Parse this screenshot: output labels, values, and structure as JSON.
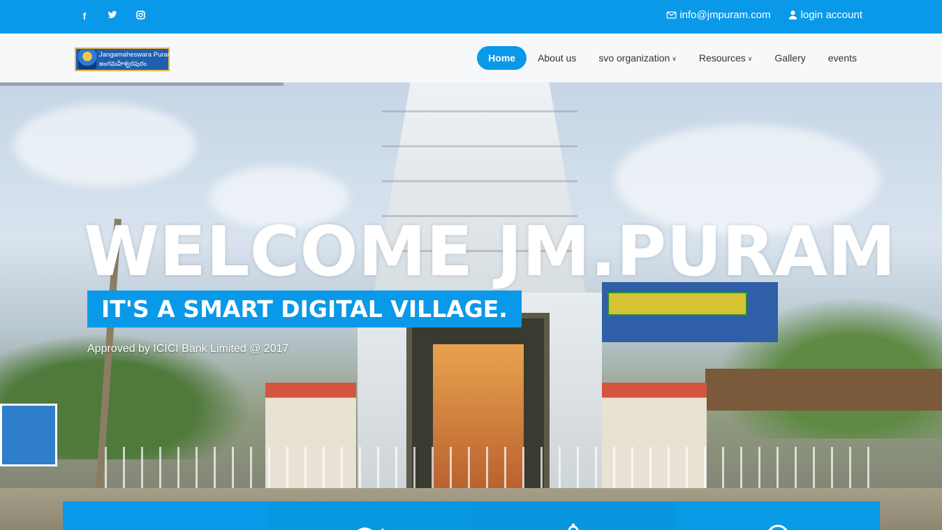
{
  "topbar": {
    "social": [
      {
        "name": "facebook-icon",
        "glyph": "f"
      },
      {
        "name": "twitter-icon",
        "glyph": "t"
      },
      {
        "name": "instagram-icon",
        "glyph": "◘"
      }
    ],
    "email": "info@jmpuram.com",
    "login": "login account"
  },
  "logo": {
    "line1": "Jangamaheswara Puram",
    "line2": "జంగమహేశ్వరపురం"
  },
  "nav": {
    "items": [
      {
        "label": "Home",
        "active": true,
        "dropdown": false
      },
      {
        "label": "About us",
        "active": false,
        "dropdown": false
      },
      {
        "label": "svo organization",
        "active": false,
        "dropdown": true
      },
      {
        "label": "Resources",
        "active": false,
        "dropdown": true
      },
      {
        "label": "Gallery",
        "active": false,
        "dropdown": false
      },
      {
        "label": "events",
        "active": false,
        "dropdown": false
      }
    ]
  },
  "hero": {
    "title": "WELCOME JM.PURAM",
    "subtitle": "IT'S A SMART DIGITAL VILLAGE.",
    "note": "Approved by ICICI Bank Limited @ 2017"
  },
  "features": [
    {
      "color": "#0a99e8",
      "icon": ""
    },
    {
      "color": "#0898e2",
      "icon": "flag-icon"
    },
    {
      "color": "#0a96df",
      "icon": "gear-icon"
    },
    {
      "color": "#0a9ae6",
      "icon": "globe-icon"
    }
  ],
  "colors": {
    "accent": "#0a99e8",
    "navbar_bg": "#f6f8f9",
    "nav_text": "#333333"
  }
}
